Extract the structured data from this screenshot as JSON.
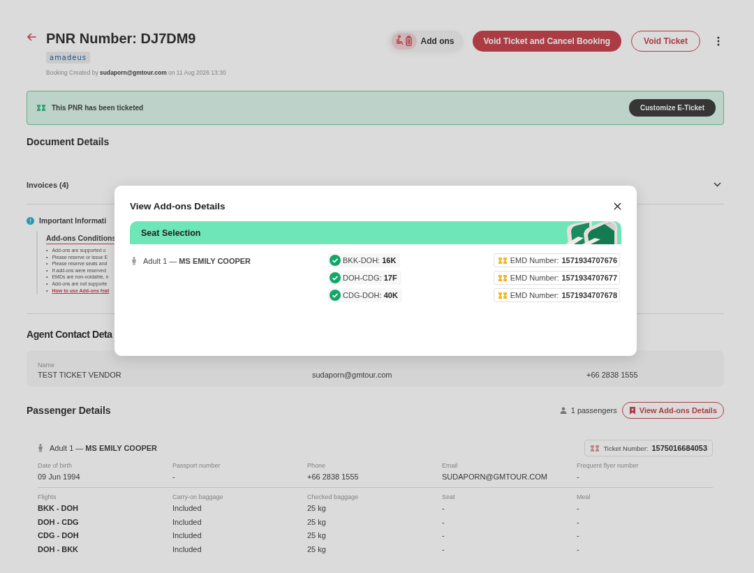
{
  "header": {
    "title_label": "PNR Number:",
    "pnr": "DJ7DM9",
    "gds": "amadeus",
    "created": "Booking Created by **sudaporn@gmtour.com** on 11 Aug 2026 13:30"
  },
  "actions": [
    {
      "kind": "addons",
      "label": "Add ons"
    },
    {
      "kind": "primary",
      "label": "Void Ticket and Cancel Booking"
    },
    {
      "kind": "outline",
      "label": "Void Ticket"
    },
    {
      "kind": "more"
    }
  ],
  "banner": {
    "message": "This PNR has been ticketed",
    "button": "Customize E-Ticket"
  },
  "document_details": {
    "title": "Document Details",
    "sections": [
      {
        "label": "Invoices (4)",
        "expanded": false
      }
    ]
  },
  "important_info": {
    "title": "Important Informati",
    "conditions_title": "Add-ons Conditions",
    "items": [
      {
        "kind": "text",
        "bullet": "•",
        "text": "Add-ons are supported o"
      },
      {
        "kind": "text",
        "bullet": "•",
        "text": "Please reserve or issue E"
      },
      {
        "kind": "text",
        "bullet": "•",
        "text": "Please reserve seats and"
      },
      {
        "kind": "text",
        "bullet": "•",
        "text": "If add-ons were reserved"
      },
      {
        "kind": "text",
        "bullet": "•",
        "text": "EMDs are non-voidable, n"
      },
      {
        "kind": "text",
        "bullet": "•",
        "text": "Add-ons are not supporte"
      },
      {
        "kind": "link",
        "bullet": "•",
        "text": "How to use Add-ons feat"
      }
    ]
  },
  "agent_contact": {
    "title": "Agent Contact Deta",
    "fields": [
      {
        "label": "Name",
        "value": "TEST TICKET VENDOR"
      },
      {
        "value": "sudaporn@gmtour.com"
      },
      {
        "value": "+66 2838 1555"
      }
    ]
  },
  "passenger_details": {
    "title": "Passenger Details",
    "count": "1 passengers",
    "view_button": "View Add-ons Details",
    "passengers": [
      {
        "label": "Adult 1 — **MS EMILY COOPER**",
        "ticket_label": "Ticket Number:",
        "ticket_number": "1575016684053",
        "info": [
          {
            "label": "Date of birth",
            "value": "09 Jun 1994"
          },
          {
            "label": "Passport number",
            "value": "-"
          },
          {
            "label": "Phone",
            "value": "+66 2838 1555"
          },
          {
            "label": "Email",
            "value": "SUDAPORN@GMTOUR.COM"
          },
          {
            "label": "Frequent flyer number",
            "value": "-"
          }
        ],
        "flight_columns": [
          "Flights",
          "Carry-on baggage",
          "Checked baggage",
          "Seat",
          "Meal"
        ],
        "flights": [
          [
            "BKK - DOH",
            "Included",
            "25 kg",
            "-",
            "-"
          ],
          [
            "DOH - CDG",
            "Included",
            "25 kg",
            "-",
            "-"
          ],
          [
            "CDG - DOH",
            "Included",
            "25 kg",
            "-",
            "-"
          ],
          [
            "DOH - BKK",
            "Included",
            "25 kg",
            "-",
            "-"
          ]
        ]
      }
    ]
  },
  "modal": {
    "title": "View Add-ons Details",
    "sections": [
      {
        "title": "Seat Selection",
        "passengers": [
          {
            "label": "Adult 1 — **MS EMILY COOPER**",
            "segments": [
              {
                "route": "BKK-DOH:",
                "seat": "16K",
                "confirmed": true,
                "emd_label": "EMD Number:",
                "emd": "1571934707676"
              },
              {
                "route": "DOH-CDG:",
                "seat": "17F",
                "confirmed": true,
                "emd_label": "EMD Number:",
                "emd": "1571934707677"
              },
              {
                "route": "CDG-DOH:",
                "seat": "40K",
                "confirmed": true,
                "emd_label": "EMD Number:",
                "emd": "1571934707678"
              }
            ]
          }
        ]
      }
    ]
  }
}
